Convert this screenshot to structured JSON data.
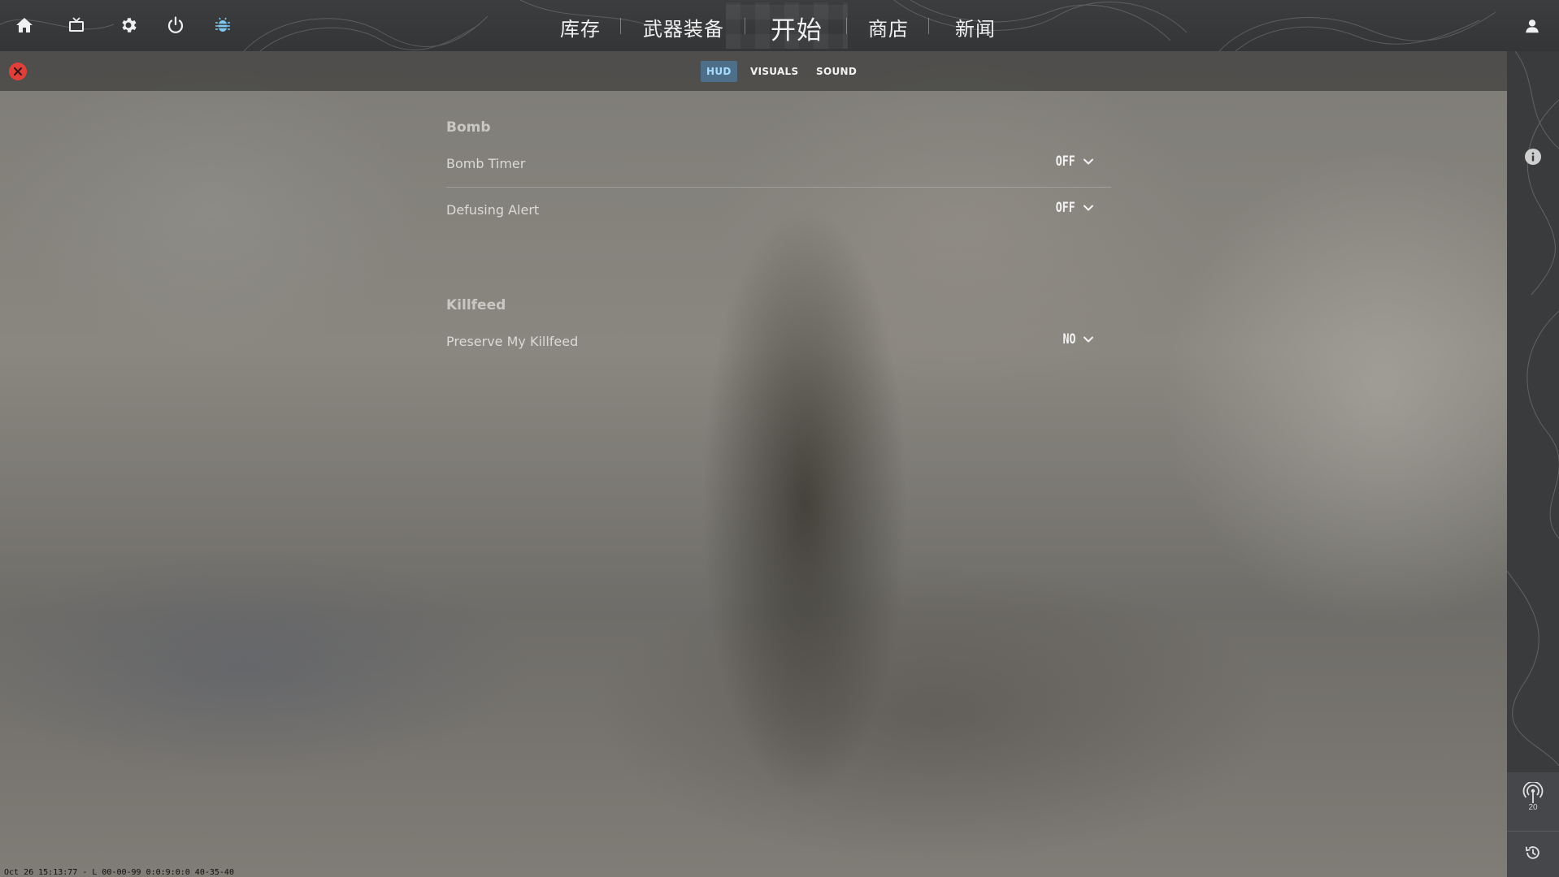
{
  "top_icons": [
    {
      "name": "home-icon"
    },
    {
      "name": "tv-icon"
    },
    {
      "name": "gear-icon"
    },
    {
      "name": "power-icon"
    },
    {
      "name": "bug-icon"
    }
  ],
  "nav": {
    "items": [
      "库存",
      "武器装备",
      "开始",
      "商店",
      "新闻"
    ],
    "active": "开始"
  },
  "subtabs": {
    "items": [
      "HUD",
      "VISUALS",
      "SOUND"
    ],
    "active": "HUD"
  },
  "sections": [
    {
      "title": "Bomb",
      "settings": [
        {
          "label": "Bomb Timer",
          "value": "OFF"
        },
        {
          "label": "Defusing Alert",
          "value": "OFF"
        }
      ]
    },
    {
      "title": "Killfeed",
      "settings": [
        {
          "label": "Preserve My Killfeed",
          "value": "NO"
        }
      ]
    }
  ],
  "right_panel": {
    "signal_count": "20"
  },
  "status_line": "Oct 26 15:13:77 - L 00-00-99 0:0:9:0:0 40-35-40",
  "colors": {
    "accent": "#a9dcff",
    "active_tab_bg": "#4d6f8a",
    "close": "#e0403a",
    "bug_icon": "#7ec8f0"
  }
}
